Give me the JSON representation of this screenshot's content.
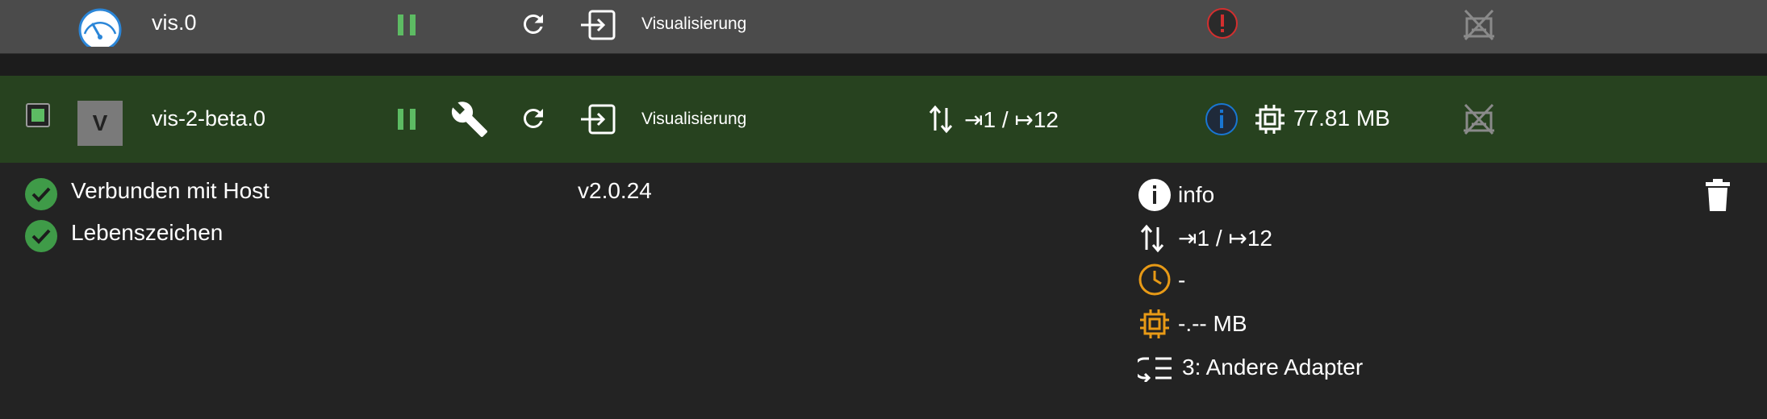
{
  "colors": {
    "row_top_bg": "#4b4b4b",
    "row_selected_bg": "#27421f",
    "details_bg": "#232323",
    "pause_green": "#5dbb63",
    "ok_green": "#3f9b48",
    "warning_red": "#d32f2f",
    "info_blue": "#1976d2",
    "orange": "#e89a16"
  },
  "rows": [
    {
      "name": "vis.0",
      "icon": "speedometer-icon",
      "description": "Visualisierung",
      "status_icon": "exclamation-icon",
      "host_icon": "host-disabled-icon"
    },
    {
      "name": "vis-2-beta.0",
      "icon_letter": "V",
      "description": "Visualisierung",
      "connections": "⇥1 / ↦12",
      "status_icon": "info-icon",
      "memory": "77.81 MB",
      "host_icon": "host-disabled-icon"
    }
  ],
  "details": {
    "connected_label": "Verbunden mit Host",
    "alive_label": "Lebenszeichen",
    "version": "v2.0.24",
    "info_label": "info",
    "connections": "⇥1 / ↦12",
    "schedule": "-",
    "memory": "-.-- MB",
    "tier": "3: Andere Adapter"
  }
}
